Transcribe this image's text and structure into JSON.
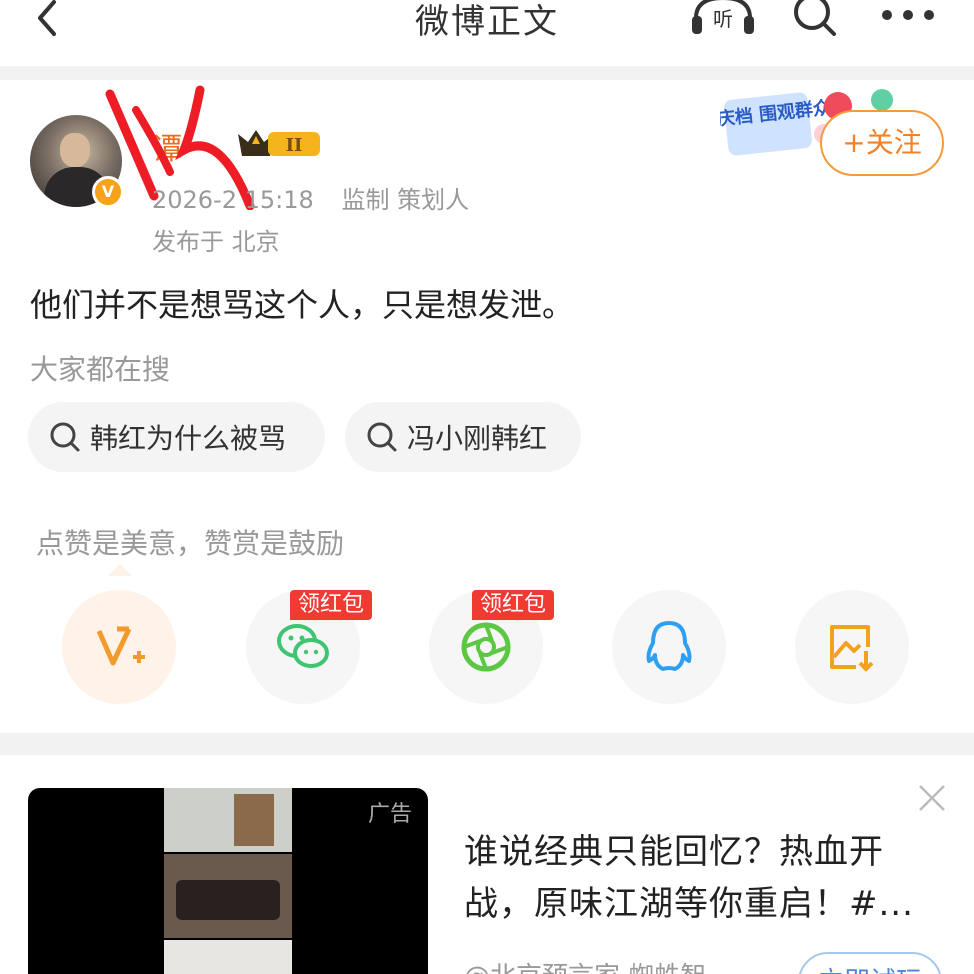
{
  "header": {
    "title": "微博正文",
    "listen_label": "听"
  },
  "post": {
    "username": "谭",
    "vip_level": "II",
    "time": "2026-2 15:18",
    "source": "监制 策划人",
    "location": "发布于 北京",
    "follow_label": "+关注",
    "promo_text": "国庆档 围观群众",
    "verified_glyph": "V",
    "content": "他们并不是想骂这个人，只是想发泄。"
  },
  "search": {
    "hint": "大家都在搜",
    "chips": [
      {
        "label": "韩红为什么被骂"
      },
      {
        "label": "冯小刚韩红"
      }
    ]
  },
  "reward": {
    "text": "点赞是美意，赞赏是鼓励"
  },
  "share": {
    "tags": [
      "领红包",
      "领红包"
    ],
    "icons": [
      "v-plus-icon",
      "wechat-icon",
      "moments-icon",
      "qq-icon",
      "save-image-icon"
    ]
  },
  "ad": {
    "tag": "广告",
    "title": "谁说经典只能回忆？热血开战，原味江湖等你重启！#...",
    "source": "@北京预言家 蜘蛛智",
    "button": "立即试玩"
  },
  "colors": {
    "accent": "#f2822a",
    "red": "#ef3b32",
    "link_blue": "#4b86d9"
  }
}
